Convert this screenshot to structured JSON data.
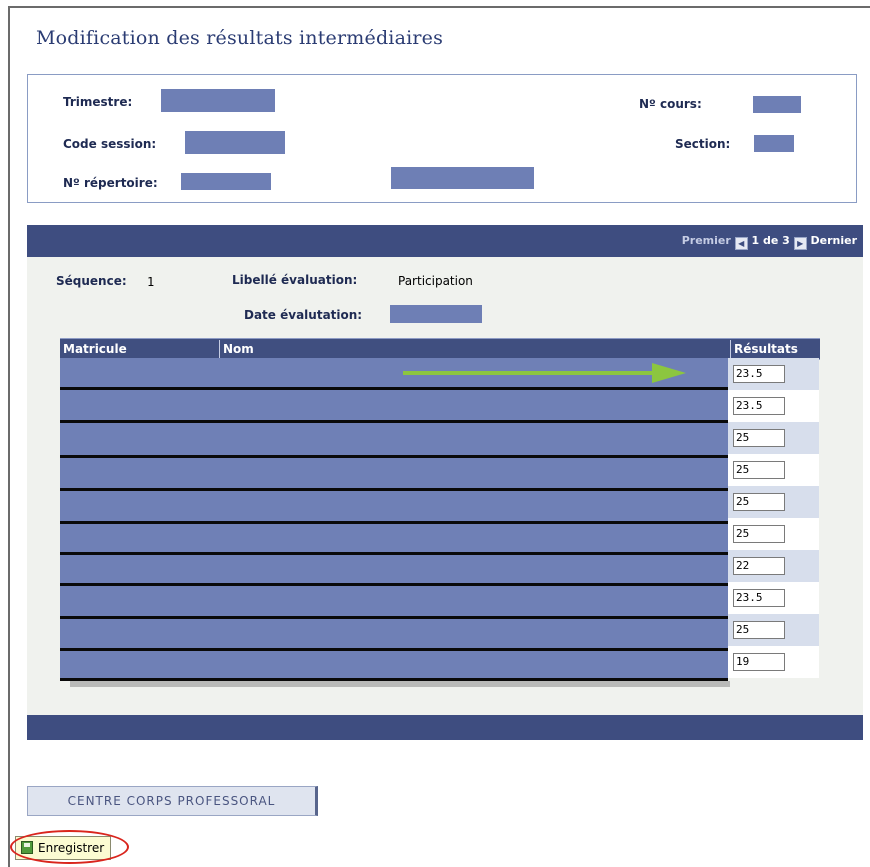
{
  "page": {
    "title": "Modification des résultats intermédiaires"
  },
  "course_info": {
    "trimestre_label": "Trimestre:",
    "code_session_label": "Code session:",
    "repertoire_label": "Nº répertoire:",
    "cours_label": "Nº cours:",
    "section_label": "Section:"
  },
  "pager": {
    "first": "Premier",
    "position": "1 de 3",
    "last": "Dernier"
  },
  "evaluation": {
    "sequence_label": "Séquence:",
    "sequence_value": "1",
    "libelle_label": "Libellé évaluation:",
    "libelle_value": "Participation",
    "date_label": "Date évalutation:"
  },
  "grid": {
    "columns": [
      "Matricule",
      "Nom",
      "Résultats"
    ],
    "rows": [
      {
        "result": "23.5"
      },
      {
        "result": "23.5"
      },
      {
        "result": "25"
      },
      {
        "result": "25"
      },
      {
        "result": "25"
      },
      {
        "result": "25"
      },
      {
        "result": "22"
      },
      {
        "result": "23.5"
      },
      {
        "result": "25"
      },
      {
        "result": "19"
      }
    ]
  },
  "nav_button": {
    "label": "CENTRE CORPS PROFESSORAL"
  },
  "save_button": {
    "label": "Enregistrer"
  },
  "colors": {
    "header_band": "#3e4d80",
    "redaction": "#6e7fb5",
    "row_alt": "#d7deec",
    "annotation_arrow": "#8cc63f",
    "annotation_circle": "#d9251d"
  },
  "icons": [
    "first-page-icon",
    "next-page-icon",
    "save-icon"
  ]
}
